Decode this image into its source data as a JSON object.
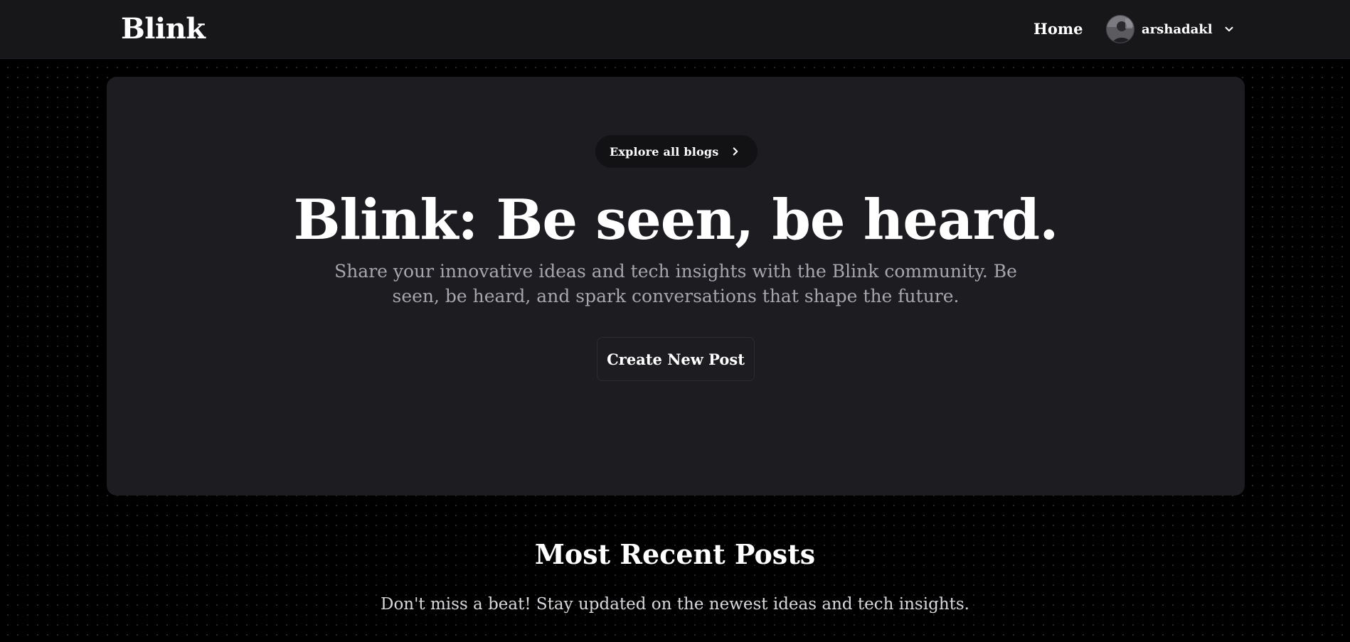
{
  "header": {
    "brand": "Blink",
    "nav_home": "Home",
    "user": {
      "name": "arshadakl",
      "avatar_icon": "user-avatar",
      "menu_icon": "chevron-down-icon"
    }
  },
  "hero": {
    "explore_label": "Explore all blogs",
    "explore_icon": "chevron-right-icon",
    "title": "Blink: Be seen, be heard.",
    "subtitle": "Share your innovative ideas and tech insights with the Blink community. Be seen, be heard, and spark conversations that shape the future.",
    "cta_label": "Create New Post"
  },
  "recent": {
    "title": "Most Recent Posts",
    "subtitle": "Don't miss a beat! Stay updated on the newest ideas and tech insights."
  },
  "colors": {
    "page_bg": "#000000",
    "navbar_bg": "#17171a",
    "hero_bg": "#1c1c21",
    "pill_bg": "#121215",
    "muted_text": "#a6a6ad"
  }
}
